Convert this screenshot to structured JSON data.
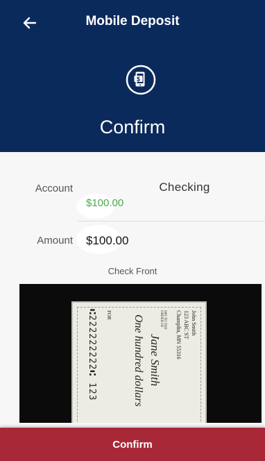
{
  "header": {
    "title": "Mobile Deposit",
    "subtitle": "Confirm",
    "background": "#0b2a5c",
    "icon": "mobile-deposit-icon"
  },
  "account": {
    "label": "Account",
    "value": "Checking",
    "balance": "$100.00"
  },
  "amount": {
    "label": "Amount",
    "value": "$100.00"
  },
  "check": {
    "section_label": "Check Front",
    "name": "John Smith",
    "address": "123 ABC ST",
    "city": "Champlin, MN 55316",
    "pay_to_label": "PAY TO THE ORDER OF",
    "payee": "Jane Smith",
    "written_amount": "One hundred dollars",
    "for_label": "FOR",
    "routing": "⑆222222222⑆ 123"
  },
  "footer": {
    "confirm_label": "Confirm",
    "color": "#a82838"
  },
  "colors": {
    "balance_green": "#4aa84f"
  }
}
